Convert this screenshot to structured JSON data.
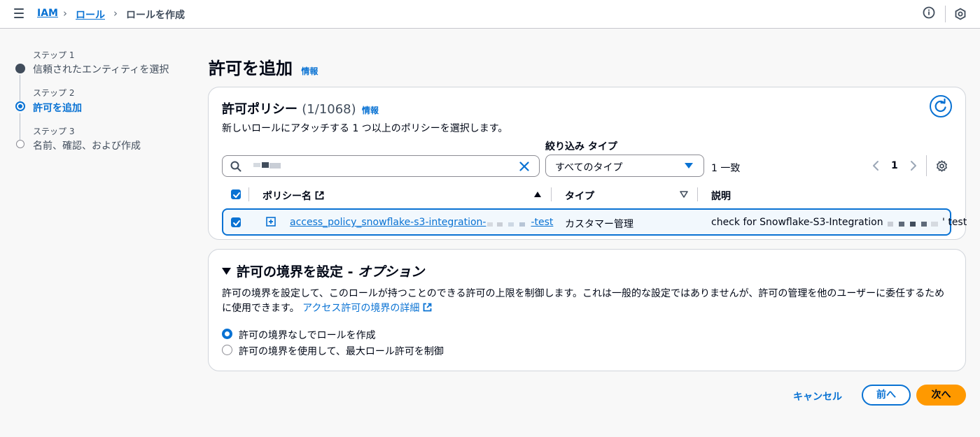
{
  "breadcrumb": {
    "items": [
      "IAM",
      "ロール",
      "ロールを作成"
    ]
  },
  "steps": [
    {
      "label": "ステップ 1",
      "title": "信頼されたエンティティを選択",
      "state": "completed"
    },
    {
      "label": "ステップ 2",
      "title": "許可を追加",
      "state": "active"
    },
    {
      "label": "ステップ 3",
      "title": "名前、確認、および作成",
      "state": "pending"
    }
  ],
  "page": {
    "title": "許可を追加",
    "info": "情報"
  },
  "policies": {
    "title": "許可ポリシー",
    "count": "(1/1068)",
    "info": "情報",
    "description": "新しいロールにアタッチする 1 つ以上のポリシーを選択します。",
    "filter_label": "絞り込み タイプ",
    "filter_value": "すべてのタイプ",
    "match_count": "1 一致",
    "page": "1",
    "columns": [
      "ポリシー名",
      "タイプ",
      "説明"
    ],
    "rows": [
      {
        "name_prefix": "access_policy_snowflake-s3-integration-",
        "name_suffix": "-test",
        "type": "カスタマー管理",
        "description_prefix": "check for Snowflake-S3-Integration",
        "description_suffix": "' test"
      }
    ]
  },
  "boundary": {
    "title": "許可の境界を設定 - ",
    "title_italic": "オプション",
    "description": "許可の境界を設定して、このロールが持つことのできる許可の上限を制御します。これは一般的な設定ではありませんが、許可の管理を他のユーザーに委任するために使用できます。",
    "link": "アクセス許可の境界の詳細",
    "options": [
      {
        "label": "許可の境界なしでロールを作成",
        "selected": true
      },
      {
        "label": "許可の境界を使用して、最大ロール許可を制御",
        "selected": false
      }
    ]
  },
  "footer": {
    "cancel": "キャンセル",
    "back": "前へ",
    "next": "次へ"
  },
  "colors": {
    "accent": "#0972d3",
    "primary_button": "#ff9900"
  }
}
